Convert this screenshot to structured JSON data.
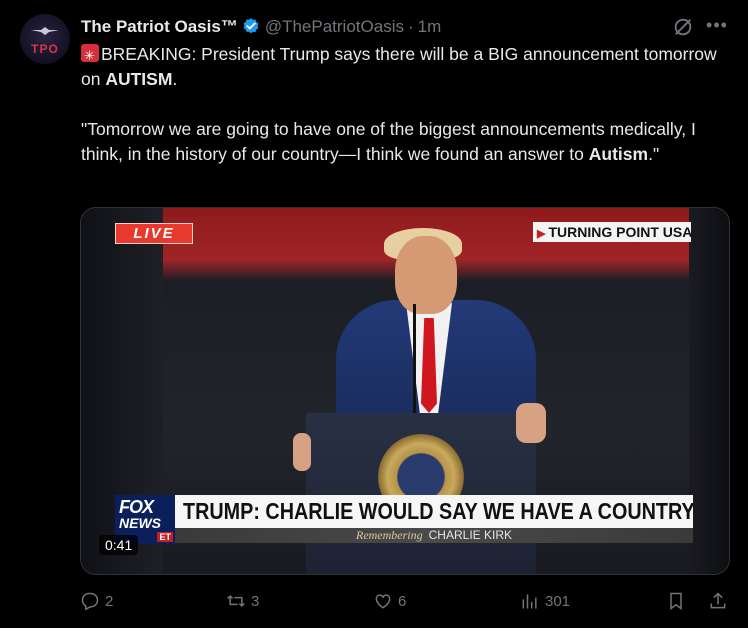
{
  "author": {
    "name": "The Patriot Oasis™",
    "handle": "@ThePatriotOasis",
    "separator": "·",
    "time": "1m",
    "avatar_text": "TPO"
  },
  "text": {
    "line1_prefix": "BREAKING: President Trump says there will be a BIG announcement tomorrow on ",
    "line1_bold": "AUTISM",
    "line1_suffix": ".",
    "quote_prefix": "\"Tomorrow we are going to have one of the biggest announcements medically, I think, in the history of our country—I think we found an answer to ",
    "quote_bold": "Autism",
    "quote_suffix": ".\""
  },
  "media": {
    "live_label": "LIVE",
    "source_label": "TURNING POINT USA",
    "network_line1": "FOX",
    "network_line2": "NEWS",
    "network_tag": "ET",
    "headline": "TRUMP: CHARLIE WOULD SAY WE HAVE A COUNTRY TO SAVE",
    "sub_prefix": "Remembering",
    "sub_name": "CHARLIE KIRK",
    "timestamp": "0:41"
  },
  "actions": {
    "replies": "2",
    "reposts": "3",
    "likes": "6",
    "views": "301"
  },
  "colors": {
    "background": "#000000",
    "text": "#e7e9ea",
    "muted": "#71767b",
    "verified": "#1d9bf0",
    "live": "#e8392f"
  },
  "icons": [
    "verified-badge-icon",
    "grok-icon",
    "more-icon",
    "siren-icon",
    "reply-icon",
    "repost-icon",
    "like-icon",
    "views-icon",
    "bookmark-icon",
    "share-icon"
  ]
}
